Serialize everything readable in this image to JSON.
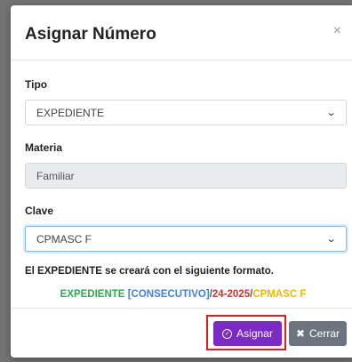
{
  "modal": {
    "title": "Asignar Número",
    "close_glyph": "×"
  },
  "form": {
    "tipo_label": "Tipo",
    "tipo_value": "EXPEDIENTE",
    "materia_label": "Materia",
    "materia_value": "Familiar",
    "clave_label": "Clave",
    "clave_value": "CPMASC F"
  },
  "format": {
    "note": "El EXPEDIENTE se creará con el siguiente formato.",
    "part_expediente": "EXPEDIENTE",
    "part_consecutivo": "[CONSECUTIVO]",
    "part_slash1": "/",
    "part_year": "24-2025",
    "part_slash2": "/",
    "part_clave": "CPMASC F"
  },
  "footer": {
    "asignar_label": "Asignar",
    "cerrar_label": "Cerrar"
  },
  "icons": {
    "chevron": "chevron-down-icon",
    "check": "check-circle-icon",
    "close": "close-icon"
  },
  "colors": {
    "primary_button": "#7b2ac8",
    "secondary_button": "#6c757d",
    "highlight_border": "#e0201d",
    "fmt_expediente": "#2fa84f",
    "fmt_consecutivo": "#3e7fe0",
    "fmt_year": "#d9302d",
    "fmt_clave": "#f3b800"
  }
}
